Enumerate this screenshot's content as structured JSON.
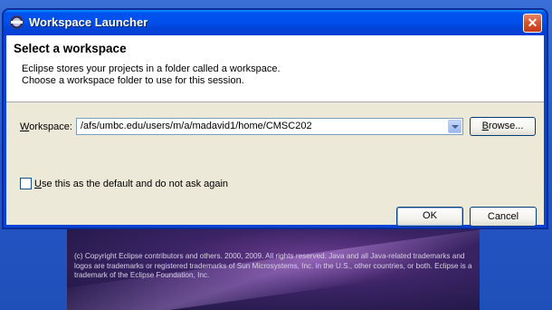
{
  "window": {
    "title": "Workspace Launcher",
    "close_symbol": "✕"
  },
  "header": {
    "title": "Select a workspace",
    "description_lines": [
      "Eclipse stores your projects in a folder called a workspace.",
      "Choose a workspace folder to use for this session."
    ]
  },
  "workspace": {
    "label_prefix": "W",
    "label_rest": "orkspace:",
    "value": "/afs/umbc.edu/users/m/a/madavid1/home/CMSC202",
    "browse_label_prefix": "B",
    "browse_label_rest": "rowse..."
  },
  "default_option": {
    "checked": false,
    "label_prefix": "U",
    "label_rest": "se this as the default and do not ask again"
  },
  "buttons": {
    "ok": "OK",
    "cancel": "Cancel"
  },
  "splash": {
    "copyright": "(c) Copyright Eclipse contributors and others. 2000, 2009. All rights reserved. Java and all Java-related trademarks and logos are trademarks or registered trademarks of Sun Microsystems, Inc. in the U.S., other countries, or both. Eclipse is a trademark of the Eclipse Foundation, Inc."
  },
  "colors": {
    "titlebar": "#0053ee",
    "dialog_face": "#ece9d8",
    "desktop": "#2c57c7"
  },
  "icons": {
    "app": "eclipse-icon",
    "dropdown": "chevron-down-icon",
    "close": "close-icon"
  }
}
